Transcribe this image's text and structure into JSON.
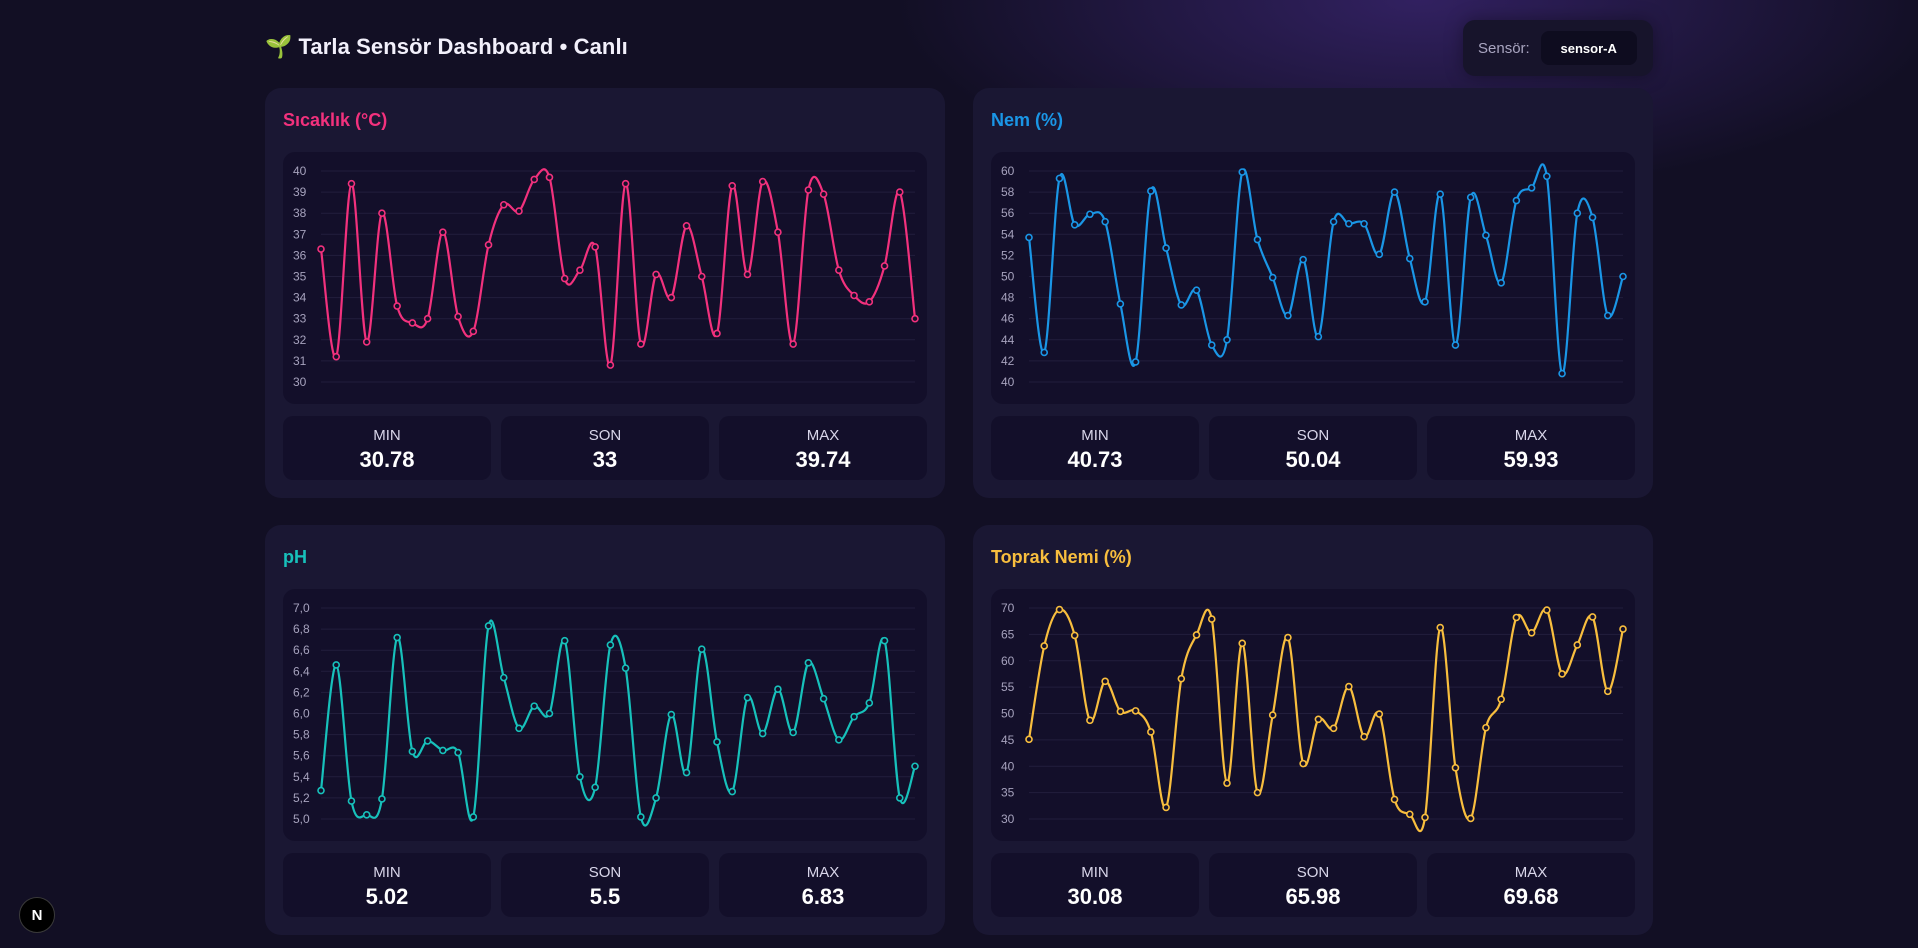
{
  "header": {
    "icon": "sprout-icon",
    "title": "Tarla Sensör Dashboard • Canlı",
    "sensor_label": "Sensör:",
    "sensor_value": "sensor-A"
  },
  "dev_badge": {
    "label": "N"
  },
  "cards": [
    {
      "title": "Sıcaklık (°C)",
      "color": "#f2317d",
      "stats": {
        "min_label": "MIN",
        "min": "30.78",
        "last_label": "SON",
        "last": "33",
        "max_label": "MAX",
        "max": "39.74"
      }
    },
    {
      "title": "Nem (%)",
      "color": "#1a96e6",
      "stats": {
        "min_label": "MIN",
        "min": "40.73",
        "last_label": "SON",
        "last": "50.04",
        "max_label": "MAX",
        "max": "59.93"
      }
    },
    {
      "title": "pH",
      "color": "#17c1bb",
      "stats": {
        "min_label": "MIN",
        "min": "5.02",
        "last_label": "SON",
        "last": "5.5",
        "max_label": "MAX",
        "max": "6.83"
      }
    },
    {
      "title": "Toprak Nemi (%)",
      "color": "#f8be3e",
      "stats": {
        "min_label": "MIN",
        "min": "30.08",
        "last_label": "SON",
        "last": "65.98",
        "max_label": "MAX",
        "max": "69.68"
      }
    }
  ],
  "chart_data": [
    {
      "type": "line",
      "title": "Sıcaklık (°C)",
      "ylim": [
        30,
        40
      ],
      "yticks": [
        "30",
        "31",
        "32",
        "33",
        "34",
        "35",
        "36",
        "37",
        "38",
        "39",
        "40"
      ],
      "grid": true,
      "series": [
        {
          "values": [
            36.3,
            31.2,
            39.4,
            31.9,
            38.0,
            33.6,
            32.8,
            33.0,
            37.1,
            33.1,
            32.4,
            36.5,
            38.4,
            38.1,
            39.6,
            39.7,
            34.9,
            35.3,
            36.4,
            30.8,
            39.4,
            31.8,
            35.1,
            34.0,
            37.4,
            35.0,
            32.3,
            39.3,
            35.1,
            39.5,
            37.1,
            31.8,
            39.1,
            38.9,
            35.3,
            34.1,
            33.8,
            35.5,
            39.0,
            33.0
          ]
        }
      ]
    },
    {
      "type": "line",
      "title": "Nem (%)",
      "ylim": [
        40,
        60
      ],
      "yticks": [
        "40",
        "42",
        "44",
        "46",
        "48",
        "50",
        "52",
        "54",
        "56",
        "58",
        "60"
      ],
      "grid": true,
      "series": [
        {
          "values": [
            53.7,
            42.8,
            59.3,
            54.9,
            55.9,
            55.2,
            47.4,
            41.9,
            58.1,
            52.7,
            47.3,
            48.7,
            43.5,
            44.0,
            59.9,
            53.5,
            49.9,
            46.3,
            51.6,
            44.3,
            55.2,
            55.0,
            55.0,
            52.1,
            58.0,
            51.7,
            47.6,
            57.8,
            43.5,
            57.5,
            53.9,
            49.4,
            57.2,
            58.4,
            59.5,
            40.8,
            56.0,
            55.6,
            46.3,
            50.0
          ]
        }
      ]
    },
    {
      "type": "line",
      "title": "pH",
      "ylim": [
        5.0,
        7.0
      ],
      "yticks": [
        "5,0",
        "5,2",
        "5,4",
        "5,6",
        "5,8",
        "6,0",
        "6,2",
        "6,4",
        "6,6",
        "6,8",
        "7,0"
      ],
      "grid": true,
      "series": [
        {
          "values": [
            5.27,
            6.46,
            5.17,
            5.04,
            5.19,
            6.72,
            5.64,
            5.74,
            5.65,
            5.63,
            5.02,
            6.83,
            6.34,
            5.86,
            6.07,
            6.0,
            6.69,
            5.4,
            5.3,
            6.65,
            6.43,
            5.02,
            5.2,
            5.99,
            5.44,
            6.61,
            5.73,
            5.26,
            6.15,
            5.81,
            6.23,
            5.82,
            6.48,
            6.14,
            5.75,
            5.97,
            6.1,
            6.69,
            5.2,
            5.5
          ]
        }
      ]
    },
    {
      "type": "line",
      "title": "Toprak Nemi (%)",
      "ylim": [
        30,
        70
      ],
      "yticks": [
        "30",
        "35",
        "40",
        "45",
        "50",
        "55",
        "60",
        "65",
        "70"
      ],
      "grid": true,
      "series": [
        {
          "values": [
            45.1,
            62.8,
            69.7,
            64.8,
            48.7,
            56.1,
            50.4,
            50.5,
            46.5,
            32.2,
            56.6,
            64.9,
            67.9,
            36.8,
            63.3,
            35.0,
            49.7,
            64.4,
            40.5,
            48.9,
            47.2,
            55.1,
            45.6,
            49.9,
            33.7,
            30.9,
            30.3,
            66.3,
            39.7,
            30.1,
            47.3,
            52.7,
            68.2,
            65.3,
            69.6,
            57.5,
            63.0,
            68.3,
            54.2,
            66.0
          ]
        }
      ]
    }
  ]
}
